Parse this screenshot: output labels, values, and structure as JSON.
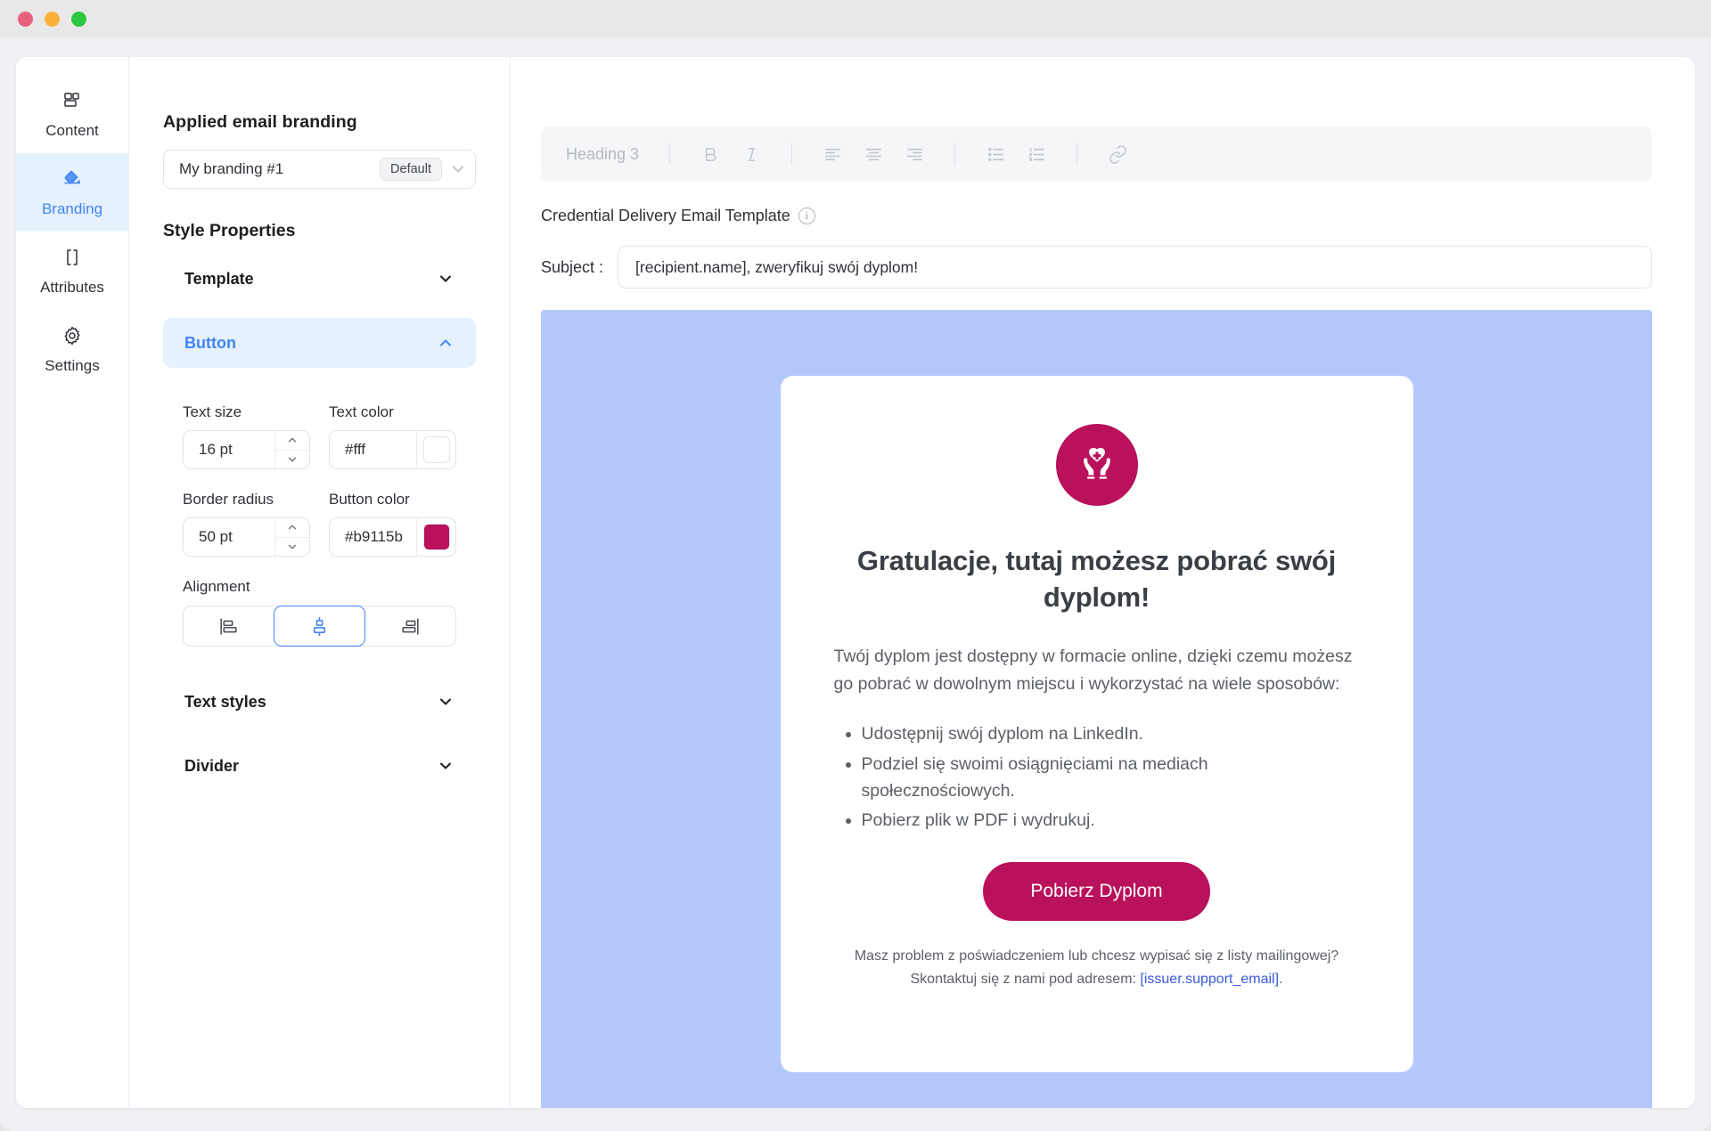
{
  "window": {
    "traffic_lights": [
      "close",
      "minimize",
      "zoom"
    ],
    "colors": {
      "close": "#e8627f",
      "minimize": "#fcb13c",
      "zoom": "#2bc741"
    }
  },
  "rail": {
    "items": [
      {
        "label": "Content",
        "icon": "layout-blocks-icon",
        "active": false
      },
      {
        "label": "Branding",
        "icon": "paint-bucket-icon",
        "active": true
      },
      {
        "label": "Attributes",
        "icon": "brackets-icon",
        "active": false
      },
      {
        "label": "Settings",
        "icon": "gear-icon",
        "active": false
      }
    ],
    "active_color": "#4285f4",
    "active_bg": "#e5f1fd"
  },
  "panel": {
    "applied_branding_title": "Applied email branding",
    "branding_value": "My branding #1",
    "branding_badge": "Default",
    "style_properties_title": "Style Properties",
    "sections": [
      {
        "label": "Template",
        "open": false
      },
      {
        "label": "Button",
        "open": true
      },
      {
        "label": "Text styles",
        "open": false
      },
      {
        "label": "Divider",
        "open": false
      }
    ],
    "button_section": {
      "text_size_label": "Text size",
      "text_size_value": "16 pt",
      "text_color_label": "Text color",
      "text_color_value": "#fff",
      "text_color_swatch": "#ffffff",
      "border_radius_label": "Border radius",
      "border_radius_value": "50 pt",
      "button_color_label": "Button color",
      "button_color_value": "#b9115b",
      "button_color_swatch": "#b9115b",
      "alignment_label": "Alignment",
      "alignment_options": [
        "align-left",
        "align-center",
        "align-right"
      ],
      "alignment_selected": "align-center"
    }
  },
  "editor": {
    "toolbar": {
      "heading_select": "Heading 3",
      "buttons": [
        "bold-icon",
        "italic-icon",
        "align-left-icon",
        "align-center-icon",
        "align-right-icon",
        "bullet-list-icon",
        "numbered-list-icon",
        "link-icon"
      ],
      "disabled": true
    },
    "template_label": "Credential Delivery Email Template",
    "info_icon": "info-icon",
    "subject_label": "Subject :",
    "subject_value": "[recipient.name], zweryfikuj swój dyplom!"
  },
  "preview": {
    "background": "#b4c8fc",
    "logo_icon": "hands-holding-heart-icon",
    "logo_bg": "#b9115b",
    "heading": "Gratulacje, tutaj możesz pobrać swój dyplom!",
    "paragraph": "Twój dyplom jest dostępny w formacie online, dzięki czemu możesz go pobrać w dowolnym miejscu i wykorzystać na wiele sposobów:",
    "bullets": [
      "Udostępnij swój dyplom na LinkedIn.",
      "Podziel się swoimi osiągnięciami na mediach społecznościowych.",
      "Pobierz plik w PDF i wydrukuj."
    ],
    "cta_label": "Pobierz Dyplom",
    "cta_color": "#b9115b",
    "footer_line1": "Masz problem z poświadczeniem lub chcesz wypisać się z listy mailingowej?",
    "footer_line2_prefix": "Skontaktuj się z nami pod adresem: ",
    "footer_link": "[issuer.support_email]",
    "footer_line2_suffix": ".",
    "footer_link_color": "#3b5bdb"
  }
}
